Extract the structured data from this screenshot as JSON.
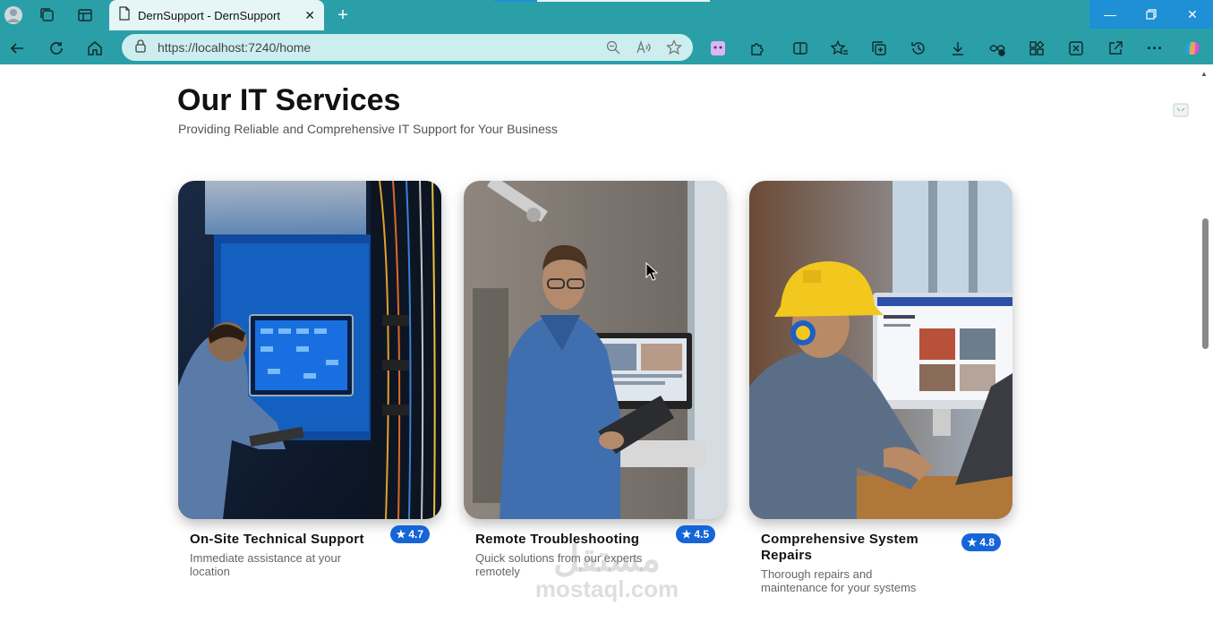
{
  "browser": {
    "tab_title": "DernSupport - DernSupport",
    "url": "https://localhost:7240/home",
    "accent_color": "#2a9fa8",
    "icons": {
      "tabbar": [
        "profile-icon",
        "collections-icon",
        "tab-actions-icon",
        "page-icon",
        "close-icon",
        "new-tab-icon"
      ],
      "toolbar": [
        "back-icon",
        "refresh-icon",
        "home-icon",
        "lock-icon",
        "zoom-icon",
        "read-aloud-icon",
        "favorite-star-icon",
        "extension-app-icon",
        "extensions-icon",
        "split-screen-icon",
        "favorites-icon",
        "collections-icon",
        "history-icon",
        "downloads-icon",
        "performance-icon",
        "apps-icon",
        "screenshot-icon",
        "share-icon",
        "more-icon",
        "copilot-icon"
      ],
      "window": [
        "minimize-icon",
        "restore-icon",
        "close-window-icon"
      ]
    }
  },
  "page": {
    "title": "Our IT Services",
    "subtitle": "Providing Reliable and Comprehensive IT Support for Your Business",
    "rating_color": "#1565d8",
    "services": [
      {
        "name": "On-Site Technical Support",
        "description": "Immediate assistance at your location",
        "rating": "4.7",
        "image": "technician-in-server-room"
      },
      {
        "name": "Remote Troubleshooting",
        "description": "Quick solutions from our experts remotely",
        "rating": "4.5",
        "image": "technician-holding-tablet"
      },
      {
        "name": "Comprehensive System Repairs",
        "description": "Thorough repairs and maintenance for your systems",
        "rating": "4.8",
        "image": "technician-with-hard-hat-at-computer"
      }
    ]
  },
  "watermark": {
    "arabic": "مستقل",
    "latin": "mostaql.com"
  }
}
